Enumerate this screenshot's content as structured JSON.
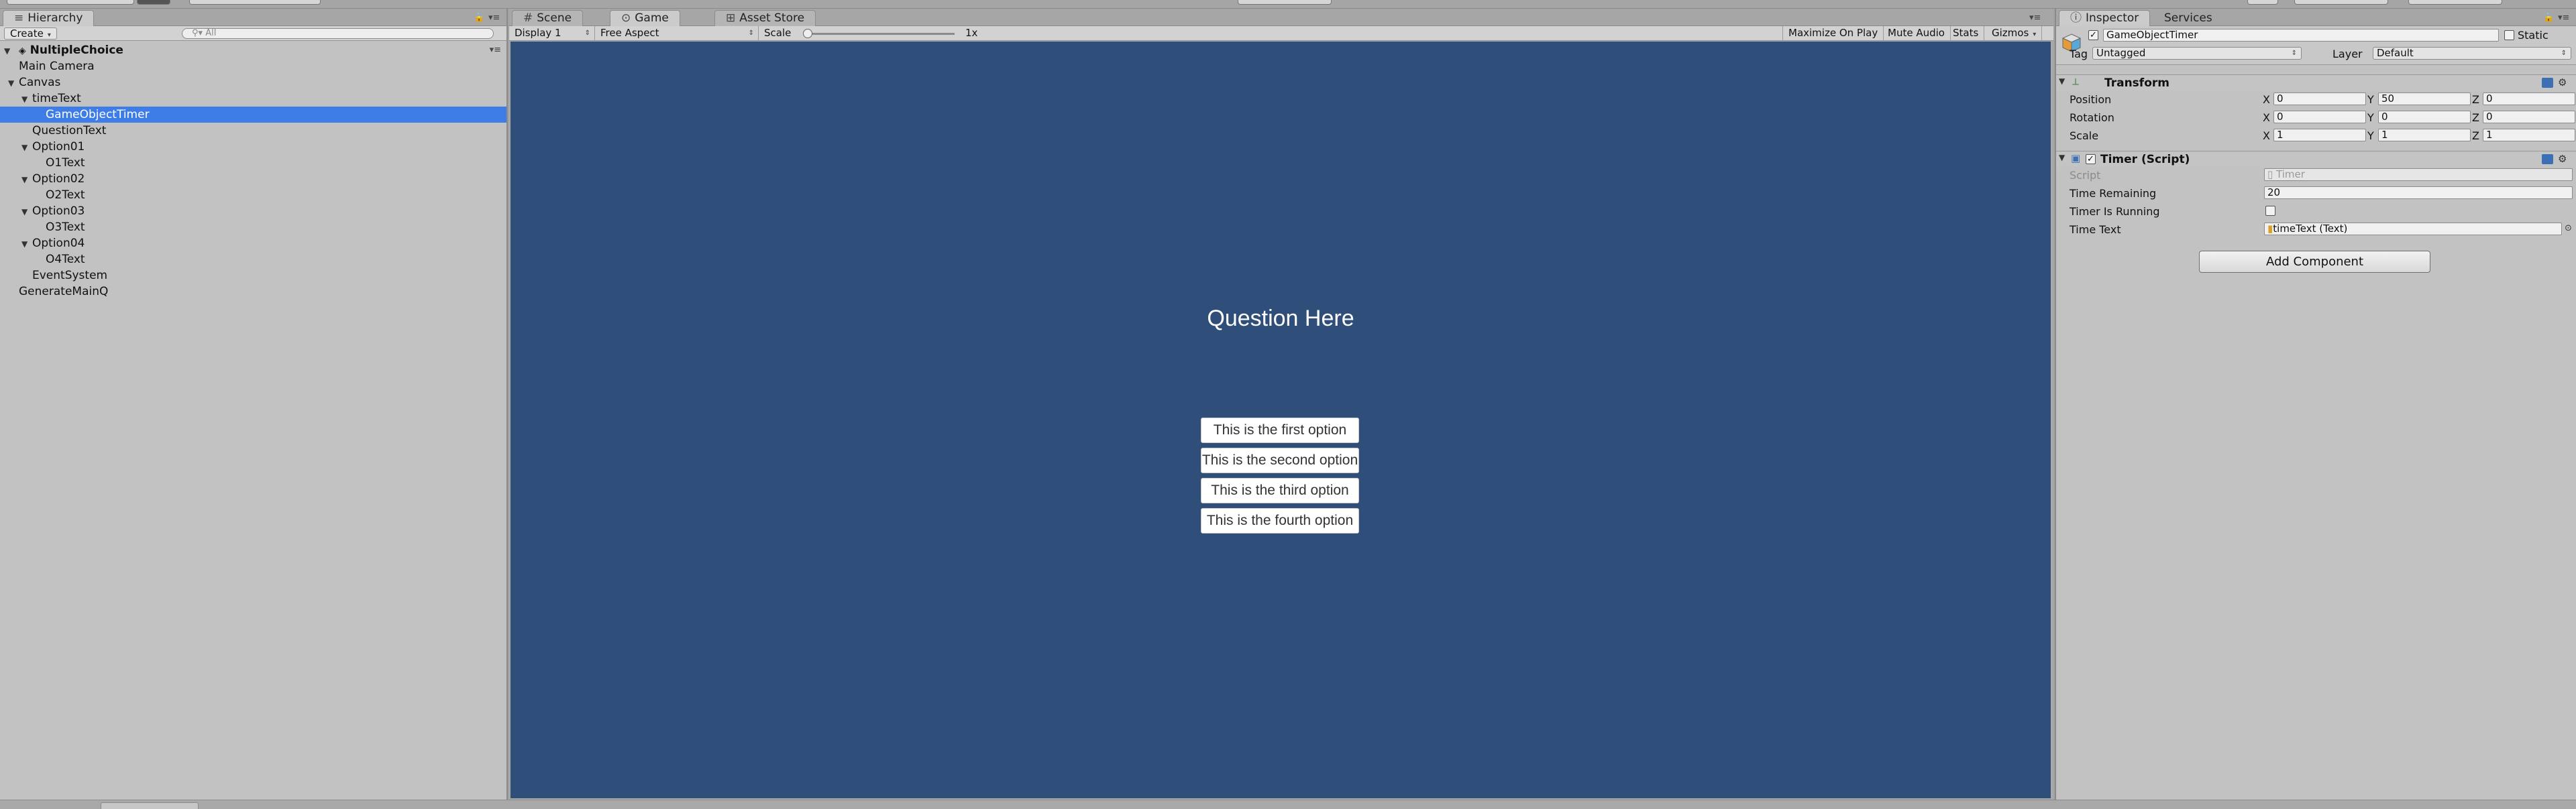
{
  "hierarchy": {
    "tab_label": "Hierarchy",
    "create_label": "Create",
    "search_placeholder": "All",
    "scene_name": "NultipleChoice",
    "items": [
      {
        "label": "Main Camera",
        "indent": 1,
        "expander": "none",
        "selected": false
      },
      {
        "label": "Canvas",
        "indent": 1,
        "expander": "open",
        "selected": false
      },
      {
        "label": "timeText",
        "indent": 2,
        "expander": "open",
        "selected": false
      },
      {
        "label": "GameObjectTimer",
        "indent": 3,
        "expander": "none",
        "selected": true
      },
      {
        "label": "QuestionText",
        "indent": 2,
        "expander": "none",
        "selected": false
      },
      {
        "label": "Option01",
        "indent": 2,
        "expander": "open",
        "selected": false
      },
      {
        "label": "O1Text",
        "indent": 3,
        "expander": "none",
        "selected": false
      },
      {
        "label": "Option02",
        "indent": 2,
        "expander": "open",
        "selected": false
      },
      {
        "label": "O2Text",
        "indent": 3,
        "expander": "none",
        "selected": false
      },
      {
        "label": "Option03",
        "indent": 2,
        "expander": "open",
        "selected": false
      },
      {
        "label": "O3Text",
        "indent": 3,
        "expander": "none",
        "selected": false
      },
      {
        "label": "Option04",
        "indent": 2,
        "expander": "open",
        "selected": false
      },
      {
        "label": "O4Text",
        "indent": 3,
        "expander": "none",
        "selected": false
      },
      {
        "label": "EventSystem",
        "indent": 2,
        "expander": "none",
        "selected": false
      },
      {
        "label": "GenerateMainQ",
        "indent": 1,
        "expander": "none",
        "selected": false
      }
    ]
  },
  "center": {
    "tabs": [
      {
        "label": "Scene",
        "icon": "scene-grid-icon",
        "active": false
      },
      {
        "label": "Game",
        "icon": "game-controller-icon",
        "active": true
      },
      {
        "label": "Asset Store",
        "icon": "asset-store-icon",
        "active": false
      }
    ],
    "toolbar": {
      "display": "Display 1",
      "aspect": "Free Aspect",
      "scale_label": "Scale",
      "scale_value": "1x",
      "scale_level": 0.0,
      "maximize": "Maximize On Play",
      "mute": "Mute Audio",
      "stats": "Stats",
      "gizmos": "Gizmos"
    },
    "game": {
      "question": "Question Here",
      "options": [
        "This is the first option",
        "This is the second option",
        "This is the third option",
        "This is the fourth option"
      ],
      "background_color": "#2f4e7a"
    }
  },
  "inspector": {
    "tabs": [
      {
        "label": "Inspector",
        "active": true
      },
      {
        "label": "Services",
        "active": false
      }
    ],
    "object_name": "GameObjectTimer",
    "active": true,
    "static_label": "Static",
    "tag_label": "Tag",
    "tag_value": "Untagged",
    "layer_label": "Layer",
    "layer_value": "Default",
    "transform": {
      "title": "Transform",
      "rows": [
        {
          "label": "Position",
          "x": "0",
          "y": "50",
          "z": "0"
        },
        {
          "label": "Rotation",
          "x": "0",
          "y": "0",
          "z": "0"
        },
        {
          "label": "Scale",
          "x": "1",
          "y": "1",
          "z": "1"
        }
      ],
      "axis": {
        "x": "X",
        "y": "Y",
        "z": "Z"
      }
    },
    "timer": {
      "title": "Timer (Script)",
      "script_label": "Script",
      "script_value": "Timer",
      "time_remaining_label": "Time Remaining",
      "time_remaining_value": "20",
      "is_running_label": "Timer Is Running",
      "is_running": false,
      "time_text_label": "Time Text",
      "time_text_value": "timeText (Text)"
    },
    "add_component": "Add Component"
  }
}
